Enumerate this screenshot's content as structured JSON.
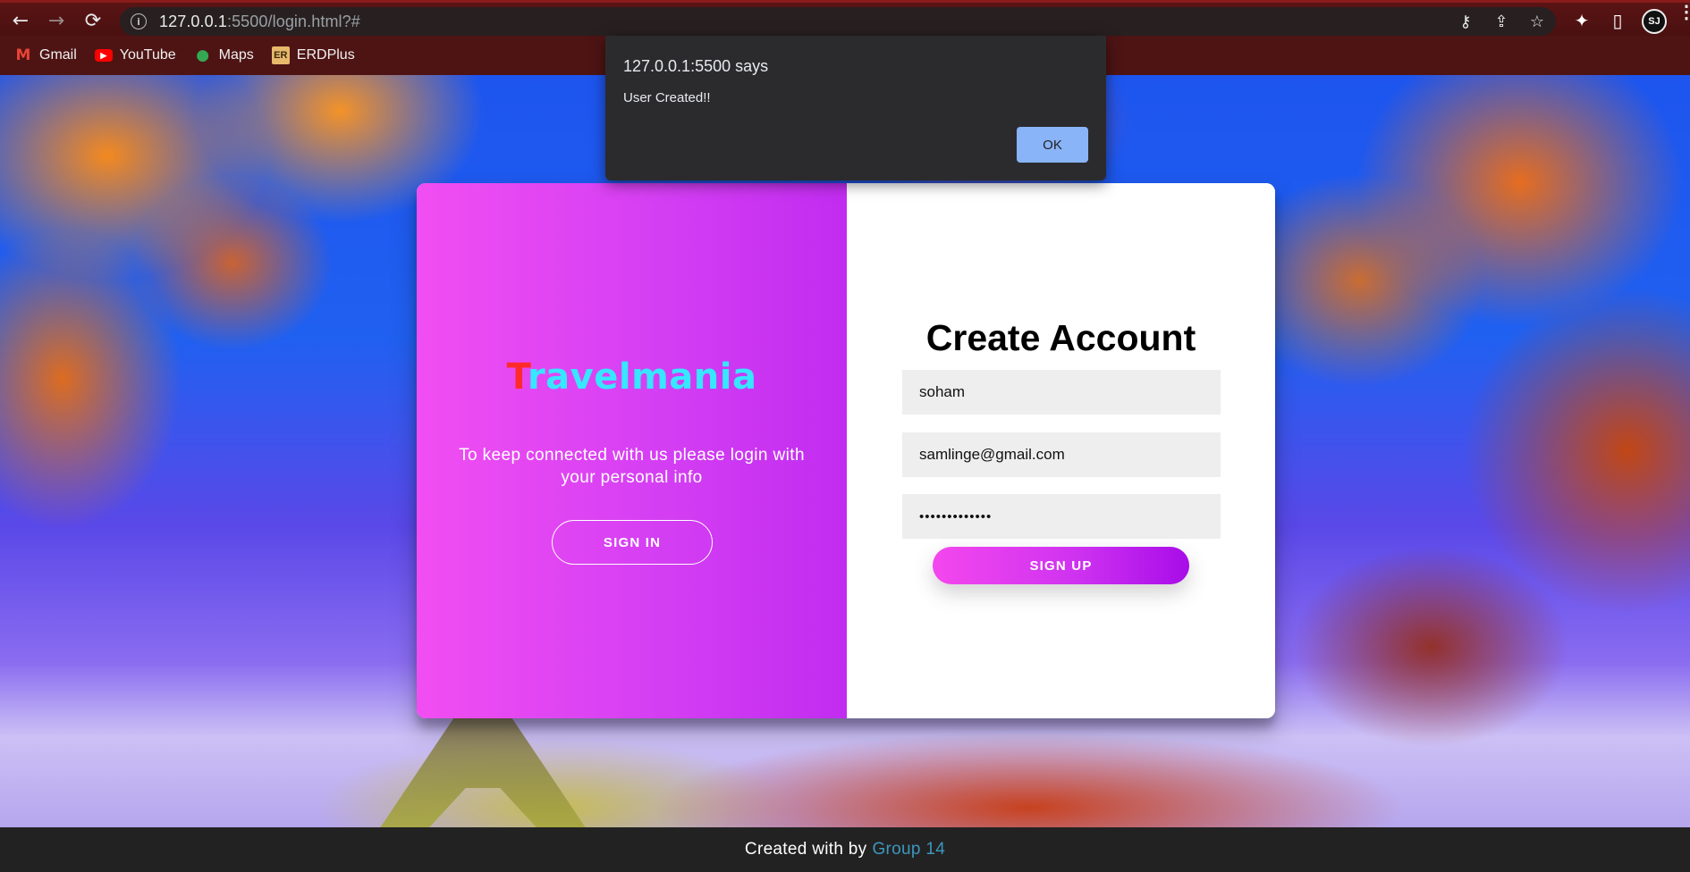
{
  "browser": {
    "url_host": "127.0.0.1",
    "url_rest": ":5500/login.html?#",
    "back_icon": "←",
    "forward_icon": "→",
    "reload_icon": "⟳",
    "info_icon": "i",
    "key_icon": "⚷",
    "share_icon": "⇪",
    "star_icon": "☆",
    "extensions_icon": "✦",
    "sidepanel_icon": "▯",
    "profile_label": "SJ",
    "menu_icon": "⋮"
  },
  "bookmarks": [
    {
      "label": "Gmail",
      "icon": "M"
    },
    {
      "label": "YouTube",
      "icon": "▶"
    },
    {
      "label": "Maps",
      "icon": "●"
    },
    {
      "label": "ERDPlus",
      "icon": "ER"
    }
  ],
  "dialog": {
    "title": "127.0.0.1:5500 says",
    "message": "User Created!!",
    "ok_label": "OK"
  },
  "overlay": {
    "brand_first": "T",
    "brand_rest": "ravelmania",
    "text": "To keep connected with us please login with your personal info",
    "signin_label": "SIGN IN"
  },
  "form": {
    "title": "Create Account",
    "name_value": "soham",
    "email_value": "samlinge@gmail.com",
    "password_value": "•••••••••••••",
    "signup_label": "SIGN UP"
  },
  "footer": {
    "text": "Created with by",
    "link": "Group 14"
  },
  "colors": {
    "brand_first": "#ff2a2a",
    "brand_rest": "#37e6ff",
    "panel_gradient_start": "#f14ef2",
    "panel_gradient_end": "#c12cf0",
    "footer_link": "#3c97bf",
    "dialog_ok": "#8ab4f8"
  }
}
